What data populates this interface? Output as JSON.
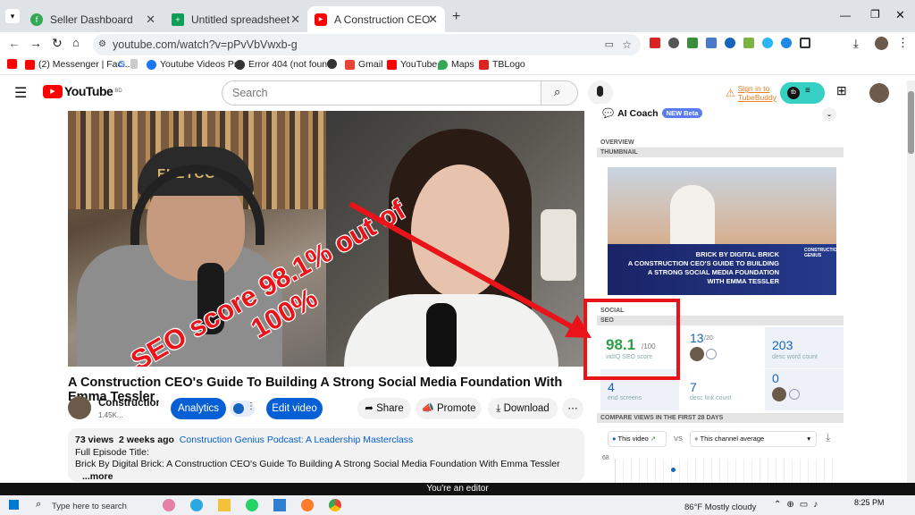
{
  "tabs": [
    {
      "label": "Seller Dashboard",
      "active": false
    },
    {
      "label": "Untitled spreadsheet - Google",
      "active": false
    },
    {
      "label": "A Construction CEO's Guide To",
      "active": true
    }
  ],
  "address": {
    "url": "youtube.com/watch?v=pPvVbVwxb-g"
  },
  "bookmarks": [
    "(2) Messenger | Fac...",
    "Youtube Videos Pr...",
    "Error 404 (not foun...",
    "Gmail",
    "YouTube",
    "Maps",
    "TBLogo"
  ],
  "youtube": {
    "logo_text": "YouTube",
    "country": "BD",
    "search_placeholder": "Search",
    "tubebuddy_signin": "Sign in to TubeBuddy"
  },
  "video": {
    "cap_logo": "FLETCO",
    "overlay_text": "SEO score 98.1% out of 100%",
    "title": "A Construction CEO's Guide To Building A Strong Social Media Foundation With Emma Tessler",
    "channel": "Construction G",
    "subs": "1.45K...",
    "analytics_label": "Analytics",
    "edit_label": "Edit video",
    "share_label": "Share",
    "promote_label": "Promote",
    "download_label": "Download",
    "views": "73 views",
    "posted": "2 weeks ago",
    "podcast": "Construction Genius Podcast: A Leadership Masterclass",
    "desc_line1": "Full Episode Title:",
    "desc_line2": "Brick By Digital Brick: A Construction CEO's Guide To Building A Strong Social Media Foundation With Emma Tessler",
    "more": "...more"
  },
  "panel": {
    "ai_coach": "AI Coach",
    "beta_badge": "NEW Beta",
    "overview": "OVERVIEW",
    "thumbnail": "THUMBNAIL",
    "thumb_line1": "BRICK BY DIGITAL BRICK",
    "thumb_line2": "A CONSTRUCTION CEO'S GUIDE TO BUILDING",
    "thumb_line3": "A STRONG SOCIAL MEDIA FOUNDATION",
    "thumb_line4": "WITH EMMA TESSLER",
    "thumb_brand": "CONSTRUCTION GENIUS",
    "social": "SOCIAL",
    "seo": "SEO",
    "seo_score": "98.1",
    "seo_out_of": "/100",
    "seo_label": "vidIQ SEO score",
    "tags_value": "13",
    "tags_total": "/20",
    "desc_words": "203",
    "desc_words_label": "desc word count",
    "end_screens": "4",
    "end_screens_label": "end screens",
    "desc_links": "7",
    "desc_links_label": "desc link count",
    "cards": "0",
    "compare": "COMPARE VIEWS IN THE FIRST 28 DAYS",
    "this_video": "This video",
    "vs": "VS",
    "this_channel": "This channel average",
    "chart_tick": "68"
  },
  "editor_banner": "You're an editor",
  "taskbar": {
    "search": "Type here to search",
    "weather": "86°F  Mostly cloudy",
    "time": "8:25 PM"
  },
  "colors": {
    "youtube_red": "#ff0000",
    "annotation_red": "#e8141a",
    "blue_button": "#065fd4",
    "vidiq_green": "#2e9e45"
  }
}
